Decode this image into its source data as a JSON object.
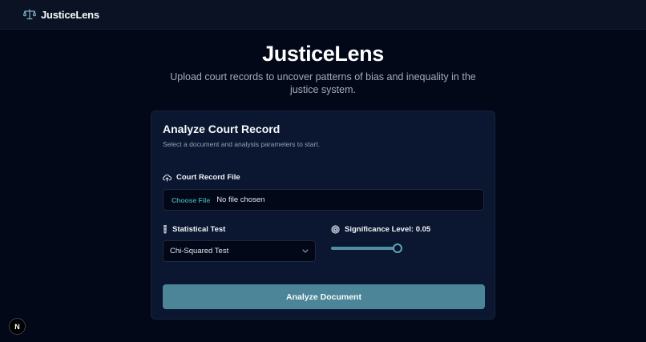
{
  "app": {
    "brand_name": "JusticeLens",
    "brand_icon": "scale-icon"
  },
  "hero": {
    "title": "JusticeLens",
    "subtitle": "Upload court records to uncover patterns of bias and inequality in the justice system."
  },
  "card": {
    "title": "Analyze Court Record",
    "description": "Select a document and analysis parameters to start.",
    "file_field": {
      "label": "Court Record File",
      "icon": "cloud-upload-icon",
      "button_label": "Choose File",
      "status": "No file chosen"
    },
    "test_field": {
      "label": "Statistical Test",
      "icon": "test-tube-icon",
      "selected": "Chi-Squared Test"
    },
    "significance_field": {
      "label": "Significance Level: 0.05",
      "icon": "target-icon",
      "slider_fraction": 0.96
    },
    "submit_label": "Analyze Document"
  },
  "badge": {
    "label": "N"
  },
  "colors": {
    "background": "#020817",
    "card": "#0b1630",
    "accent": "#4b8597",
    "link": "#3f9aa6"
  }
}
